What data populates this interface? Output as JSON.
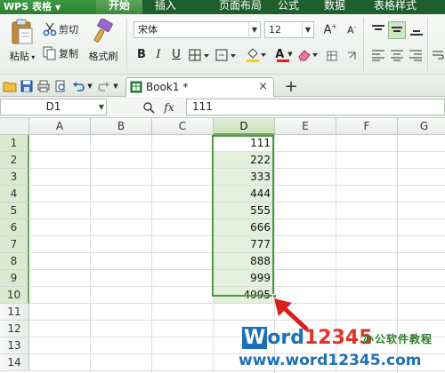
{
  "app": {
    "name": "WPS 表格",
    "menu_arrow": "▼"
  },
  "menu_tabs": [
    "开始",
    "插入",
    "页面布局",
    "公式",
    "数据",
    "表格样式"
  ],
  "ribbon": {
    "paste_label": "粘贴",
    "cut_label": "剪切",
    "copy_label": "复制",
    "format_painter_label": "格式刷",
    "font_name": "宋体",
    "font_size": "12",
    "bold": "B",
    "italic": "I",
    "underline": "U",
    "font_color_letter": "A"
  },
  "doc_tab": {
    "title": "Book1 *",
    "close": "×",
    "new_tab": "+"
  },
  "formula_bar": {
    "cell_ref": "D1",
    "fx": "fx",
    "value": "111"
  },
  "sheet": {
    "columns": [
      "A",
      "B",
      "C",
      "D",
      "E",
      "F",
      "G"
    ],
    "rows": [
      "1",
      "2",
      "3",
      "4",
      "5",
      "6",
      "7",
      "8",
      "9",
      "10",
      "11",
      "12",
      "13",
      "14"
    ],
    "selected_column": "D",
    "selected_range": "D1:D10",
    "d_values": [
      "111",
      "222",
      "333",
      "444",
      "555",
      "666",
      "777",
      "888",
      "999",
      "4995"
    ]
  },
  "watermark": {
    "w": "W",
    "ord": "ord",
    "num": "12345",
    "cn": "办公软件教程",
    "url": "www.word12345.com"
  },
  "colors": {
    "menubar": "#1f5f2e",
    "app_button": "#2d7f33",
    "selection_border": "#4e9a43",
    "selection_fill": "#e3f0dc",
    "arrow": "#d8201f"
  }
}
